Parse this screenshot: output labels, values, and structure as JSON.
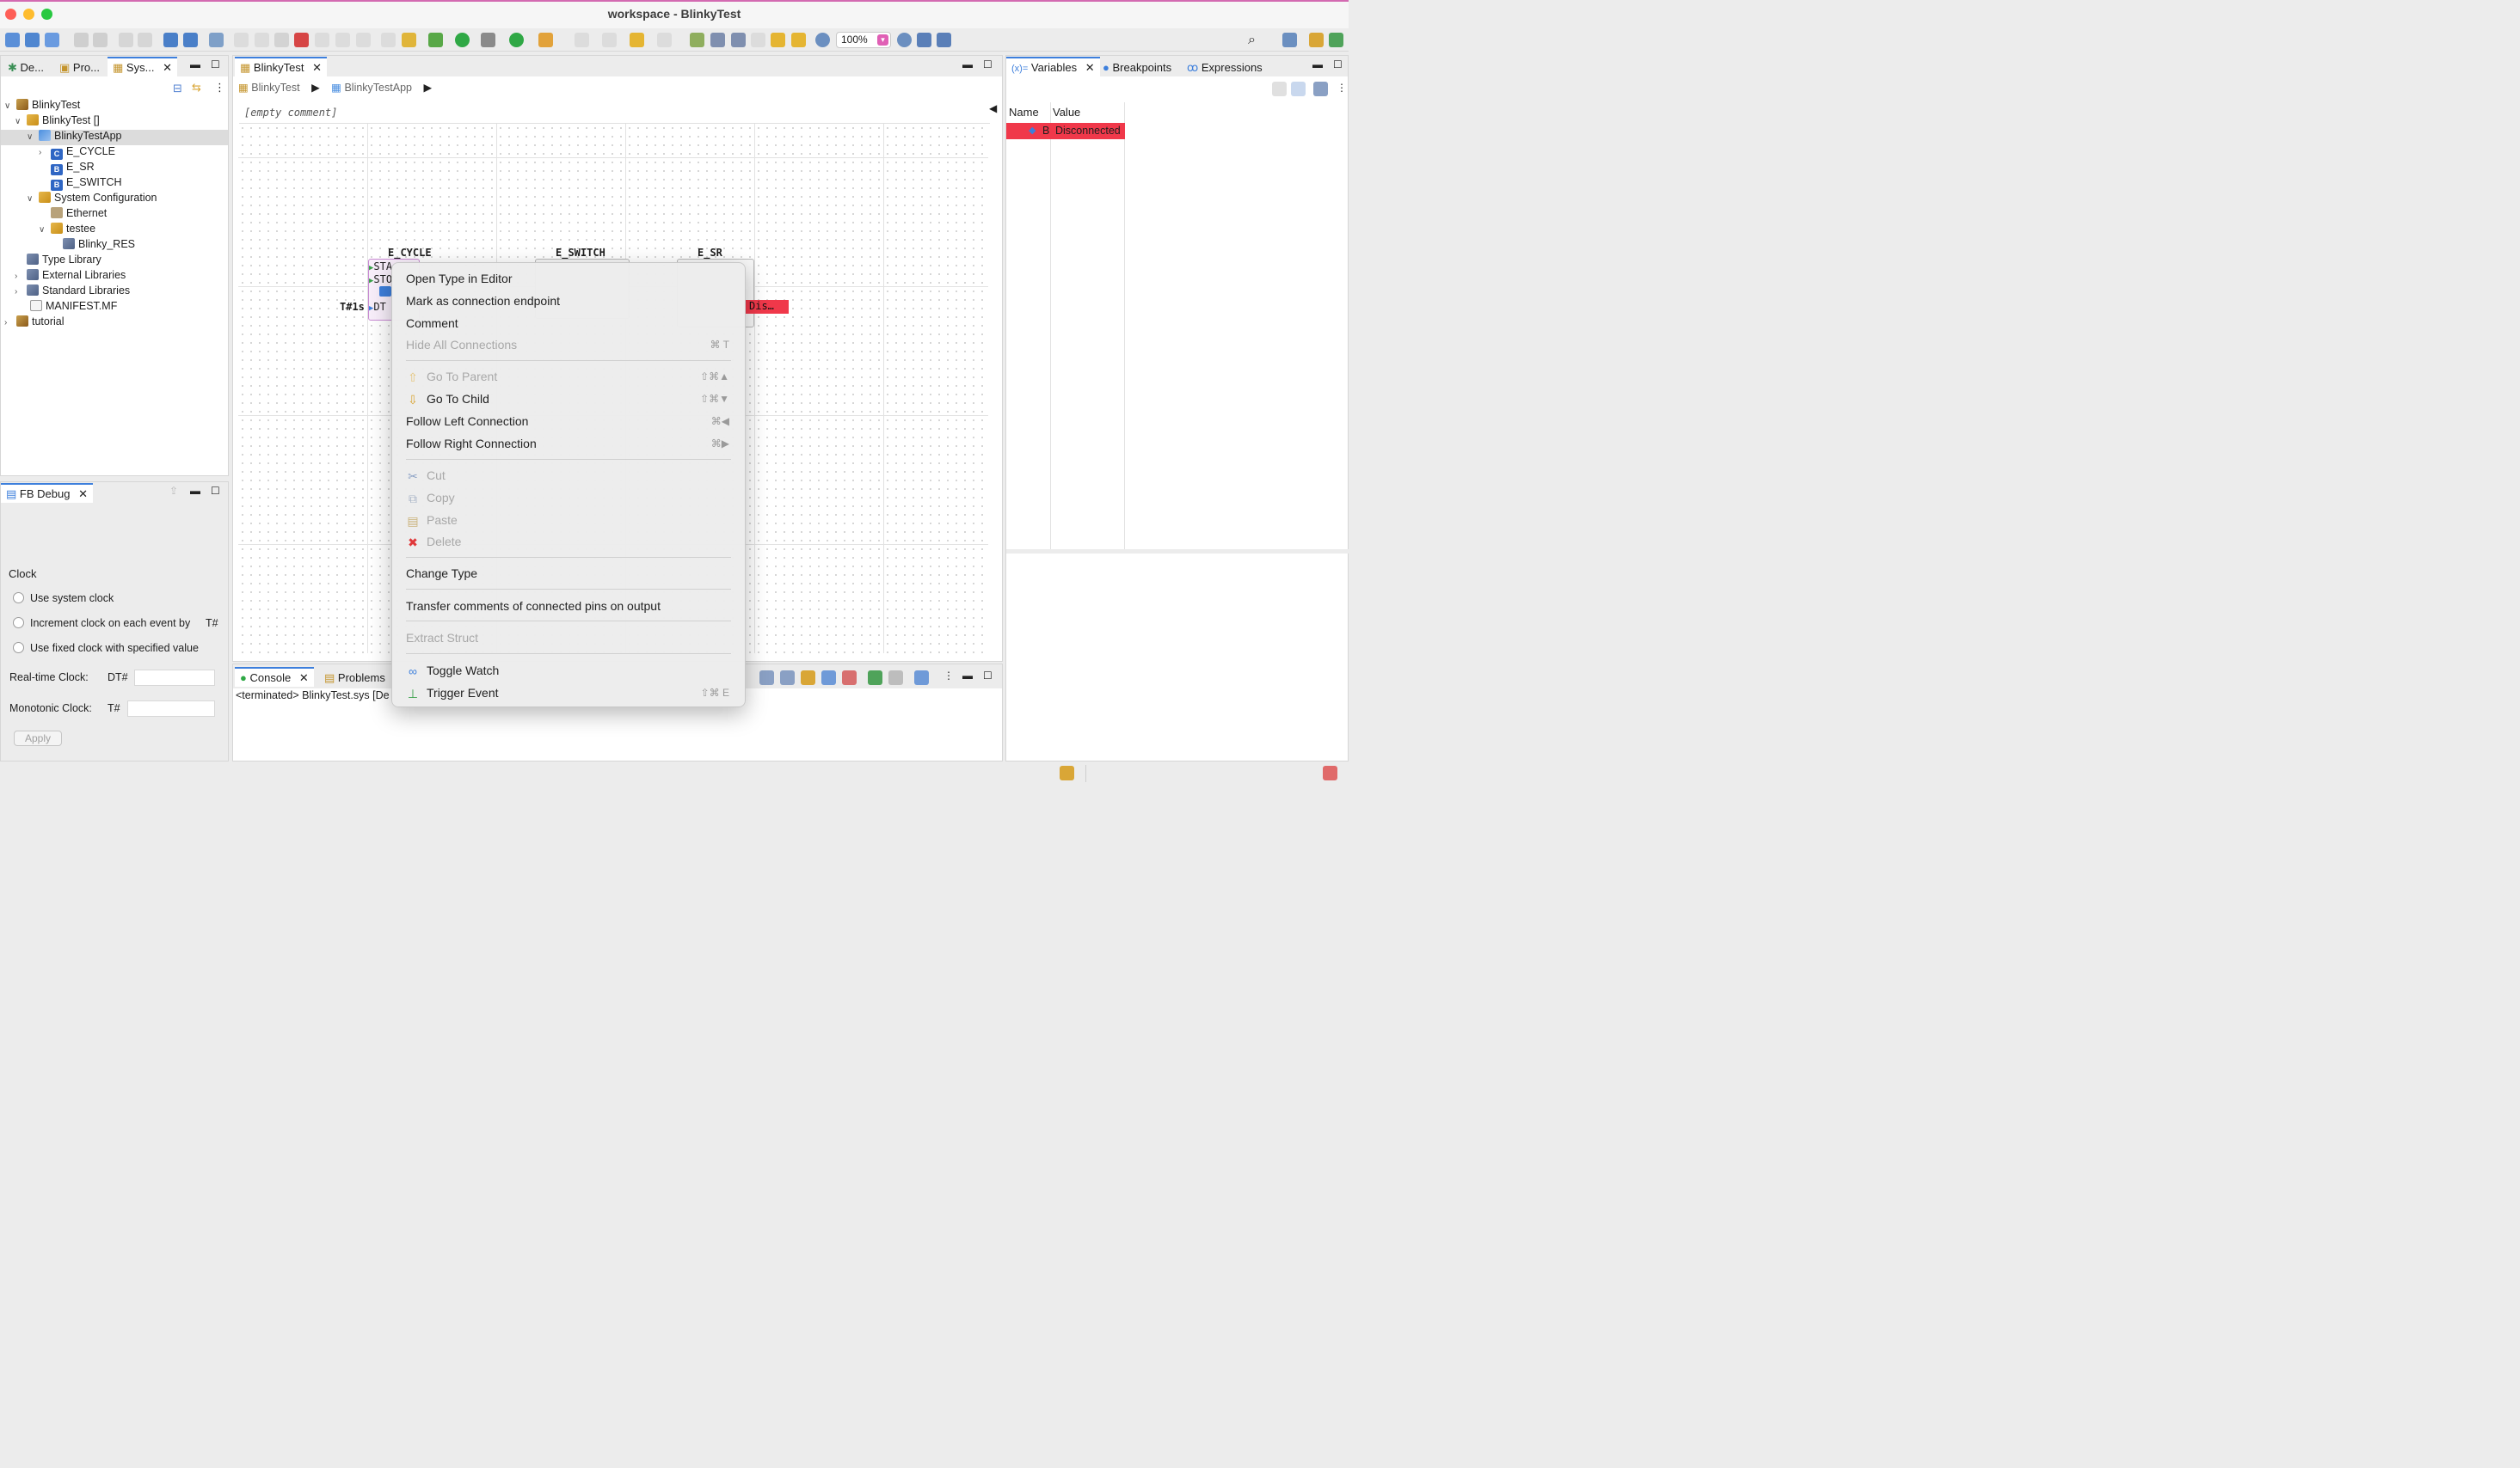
{
  "window": {
    "title": "workspace - BlinkyTest"
  },
  "toolbar": {
    "zoom": "100%"
  },
  "left_tabs": [
    "De...",
    "Pro...",
    "Sys..."
  ],
  "tree": {
    "items": [
      {
        "label": "BlinkyTest"
      },
      {
        "label": "BlinkyTest []"
      },
      {
        "label": "BlinkyTestApp"
      },
      {
        "label": "E_CYCLE"
      },
      {
        "label": "E_SR"
      },
      {
        "label": "E_SWITCH"
      },
      {
        "label": "System Configuration"
      },
      {
        "label": "Ethernet"
      },
      {
        "label": "testee"
      },
      {
        "label": "Blinky_RES"
      },
      {
        "label": "Type Library"
      },
      {
        "label": "External Libraries"
      },
      {
        "label": "Standard Libraries"
      },
      {
        "label": "MANIFEST.MF"
      },
      {
        "label": "tutorial"
      }
    ]
  },
  "editor": {
    "tab": "BlinkyTest",
    "breadcrumb": [
      "BlinkyTest",
      "BlinkyTestApp"
    ],
    "comment": "[empty comment]",
    "fb_ecycle": "E_CYCLE",
    "fb_eswitch": "E_SWITCH",
    "fb_esr": "E_SR",
    "pin_start": "STA",
    "pin_stop": "STO",
    "pin_dt": "DT",
    "dt_value": "T#1s",
    "watch_value": "Dis…"
  },
  "context_menu": {
    "items": [
      {
        "label": "Open Type in Editor",
        "shortcut": ""
      },
      {
        "label": "Mark as connection endpoint",
        "shortcut": ""
      },
      {
        "label": "Comment",
        "shortcut": ""
      },
      {
        "label": "Hide All Connections",
        "shortcut": "⌘ T"
      },
      {
        "label": "Go To Parent",
        "shortcut": "⇧⌘▲"
      },
      {
        "label": "Go To Child",
        "shortcut": "⇧⌘▼"
      },
      {
        "label": "Follow Left Connection",
        "shortcut": "⌘◀"
      },
      {
        "label": "Follow Right Connection",
        "shortcut": "⌘▶"
      },
      {
        "label": "Cut",
        "shortcut": ""
      },
      {
        "label": "Copy",
        "shortcut": ""
      },
      {
        "label": "Paste",
        "shortcut": ""
      },
      {
        "label": "Delete",
        "shortcut": ""
      },
      {
        "label": "Change Type",
        "shortcut": ""
      },
      {
        "label": "Transfer comments of connected pins on output",
        "shortcut": ""
      },
      {
        "label": "Extract Struct",
        "shortcut": ""
      },
      {
        "label": "Toggle Watch",
        "shortcut": ""
      },
      {
        "label": "Trigger Event",
        "shortcut": "⇧⌘ E"
      }
    ]
  },
  "right_panel": {
    "tabs": [
      "Variables",
      "Breakpoints",
      "Expressions"
    ],
    "tab_prefix": "(x)=",
    "columns": [
      "Name",
      "Value"
    ],
    "row": {
      "name": "B",
      "value": "Disconnected"
    }
  },
  "fb_debug": {
    "tab": "FB Debug",
    "clock_label": "Clock",
    "options": [
      "Use system clock",
      "Increment clock on each event by",
      "Use fixed clock with specified value"
    ],
    "increment_prefix": "T#",
    "realtime_label": "Real-time Clock:",
    "realtime_prefix": "DT#",
    "monotonic_label": "Monotonic Clock:",
    "monotonic_prefix": "T#",
    "apply": "Apply"
  },
  "console": {
    "tabs": [
      "Console",
      "Problems"
    ],
    "text": "<terminated> BlinkyTest.sys [De"
  },
  "colors": {
    "accent": "#3d7fdc",
    "error": "#f0384a",
    "magenta": "#e05fb5"
  }
}
